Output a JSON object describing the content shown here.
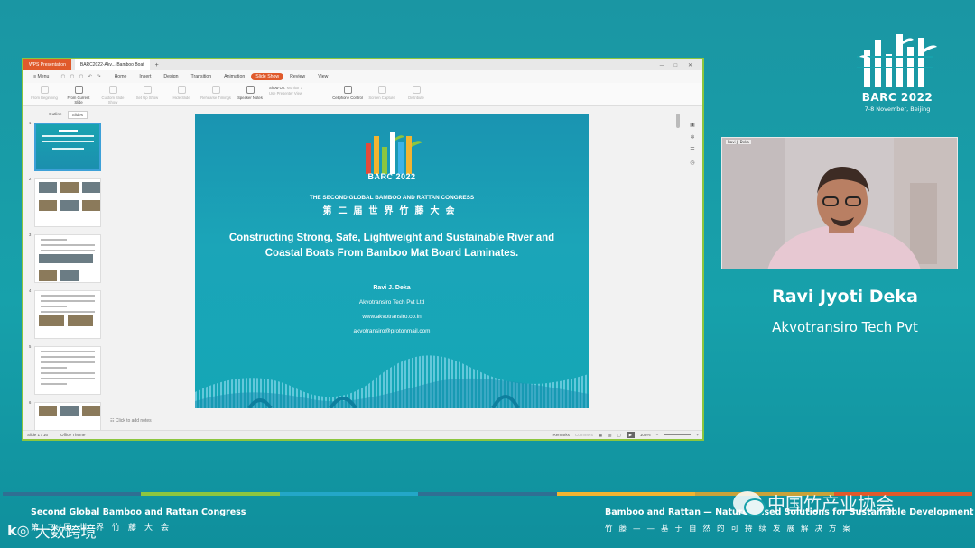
{
  "brand": {
    "title": "BARC 2022",
    "date": "7-8 November, Beijing"
  },
  "app": {
    "tabbar": {
      "app_tab": "WPS Presentation",
      "doc_tab": "BARC2022-Akv...-Bamboo Boat",
      "plus": "+",
      "win_controls": "─ □ ✕"
    },
    "menu": {
      "file": "≡ Menu",
      "items": [
        "Home",
        "Insert",
        "Design",
        "Transition",
        "Animation",
        "Slide Show",
        "Review",
        "View"
      ],
      "active": "Slide Show"
    },
    "ribbon": {
      "from_beginning": "From Beginning",
      "from_current": "From Current Slide",
      "custom_show": "Custom Slide Show",
      "set_up": "Set Up Show",
      "hide_slide": "Hide Slide",
      "rehearse": "Rehearse Timings",
      "speaker_notes": "Speaker Notes",
      "show_on_label": "Show On:",
      "show_on_value": "Monitor 1",
      "use_presenter": "Use Presenter View",
      "cellphone": "Cellphone Control",
      "pointer_capture": "Screen Capture",
      "distribute": "Distribute"
    },
    "outline_tabs": [
      "Outline",
      "Slides"
    ],
    "thumbs": [
      "1",
      "2",
      "3",
      "4",
      "5",
      "6"
    ],
    "notes_placeholder": "Click to add notes",
    "status": {
      "slide_count": "Slide 1 / 16",
      "theme": "Office Theme",
      "remarks": "Remarks",
      "comment": "Comment",
      "zoom": "103%"
    }
  },
  "slide": {
    "barc": "BARC 2022",
    "congress": "THE SECOND GLOBAL BAMBOO AND RATTAN CONGRESS",
    "congress_cn": "第二届世界竹藤大会",
    "title": "Constructing Strong, Safe, Lightweight and Sustainable River and Coastal Boats From Bamboo Mat Board Laminates.",
    "author": "Ravi J. Deka",
    "company": "Akvotransiro Tech Pvt Ltd",
    "website": "www.akvotransiro.co.in",
    "email": "akvotransiro@protonmail.com"
  },
  "camera": {
    "label": "Ravi J. Deka"
  },
  "speaker": {
    "name": "Ravi Jyoti Deka",
    "org": "Akvotransiro Tech Pvt"
  },
  "footer": {
    "left_en": "Second Global Bamboo and Rattan Congress",
    "left_cn": "第二届世界竹藤大会",
    "right_en": "Bamboo and Rattan — Nature-Based Solutions for Sustainable Development",
    "right_cn": "竹藤——基于自然的可持续发展解决方案"
  },
  "watermarks": {
    "wechat": "中国竹产业协会",
    "left": "大数跨境"
  },
  "colors": {
    "stage": "#17a1ab",
    "accent": "#e05a2b",
    "frame": "#8cc63f",
    "slide": "#1a9bb3"
  }
}
